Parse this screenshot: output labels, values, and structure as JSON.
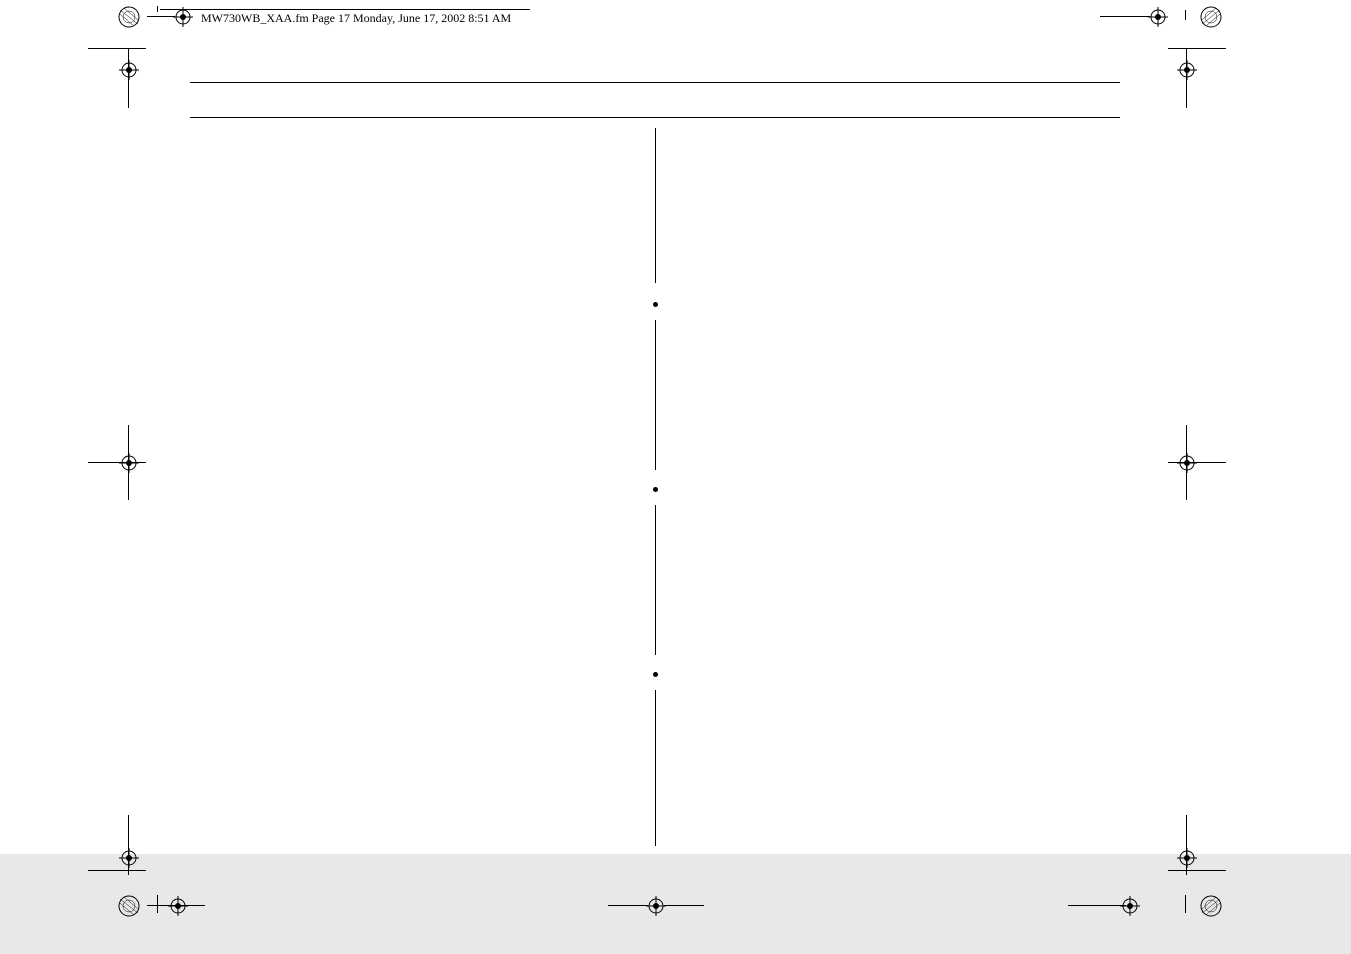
{
  "header": {
    "filename_line": "MW730WB_XAA.fm  Page 17  Monday, June 17, 2002  8:51 AM"
  }
}
